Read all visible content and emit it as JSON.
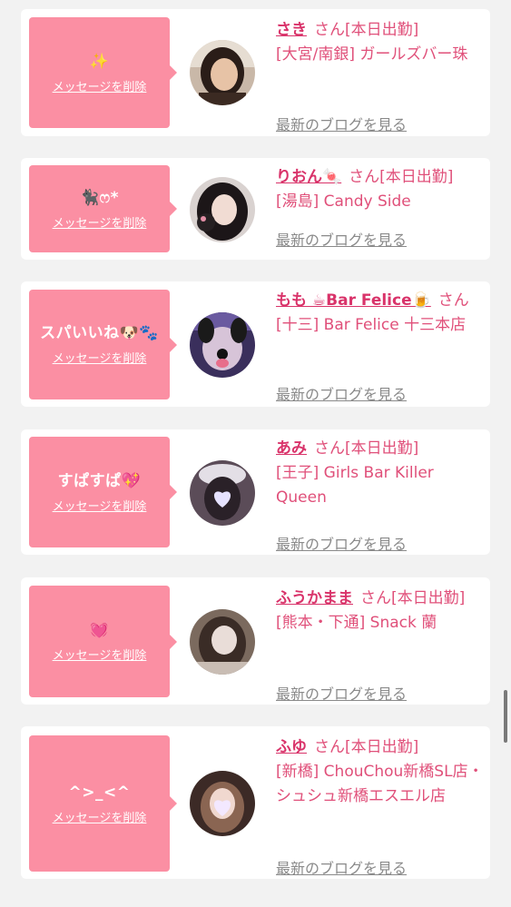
{
  "cards": [
    {
      "message": "✨",
      "delete_label": "メッセージを削除",
      "name": "さき",
      "suffix": "さん[本日出勤]",
      "shop": "[大宮/南銀] ガールズバー珠",
      "blog_label": "最新のブログを見る",
      "avatar_icon": "woman-photo-avatar"
    },
    {
      "message": "🐈‍⬛ෆ*",
      "delete_label": "メッセージを削除",
      "name": "りおん🍬",
      "suffix": "さん[本日出勤]",
      "shop": "[湯島] Candy Side",
      "blog_label": "最新のブログを見る",
      "avatar_icon": "woman-photo-avatar"
    },
    {
      "message": "スパいいね🐶🐾",
      "delete_label": "メッセージを削除",
      "name": "もも ☕Bar Felice🍺",
      "suffix": "さん",
      "shop": "[十三] Bar Felice 十三本店",
      "blog_label": "最新のブログを見る",
      "avatar_icon": "dog-filter-photo-avatar"
    },
    {
      "message": "すぱすぱ💖",
      "delete_label": "メッセージを削除",
      "name": "あみ",
      "suffix": "さん[本日出勤]",
      "shop": "[王子] Girls Bar Killer Queen",
      "blog_label": "最新のブログを見る",
      "avatar_icon": "heart-masked-photo-avatar"
    },
    {
      "message": "💓",
      "delete_label": "メッセージを削除",
      "name": "ふうかまま",
      "suffix": "さん[本日出勤]",
      "shop": "[熊本・下通] Snack 蘭",
      "blog_label": "最新のブログを見る",
      "avatar_icon": "blurred-face-photo-avatar"
    },
    {
      "message": "^>_<^",
      "delete_label": "メッセージを削除",
      "name": "ふゆ",
      "suffix": "さん[本日出勤]",
      "shop": "[新橋] ChouChou新橋SL店・シュシュ新橋エスエル店",
      "blog_label": "最新のブログを見る",
      "avatar_icon": "heart-masked-photo-avatar"
    }
  ],
  "colors": {
    "bubble": "#fb8fa3",
    "name": "#d9336a",
    "text": "#e0507a",
    "link": "#8a8a8a",
    "background": "#f2f2f2"
  }
}
